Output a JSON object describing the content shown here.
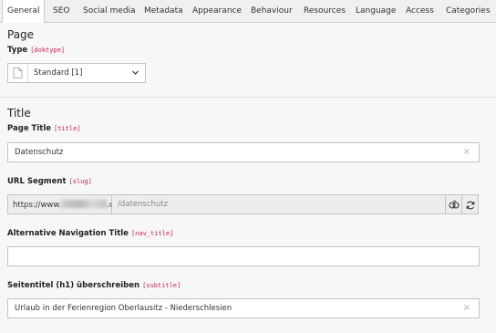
{
  "tabs": [
    {
      "label": "General",
      "active": true
    },
    {
      "label": "SEO"
    },
    {
      "label": "Social media"
    },
    {
      "label": "Metadata"
    },
    {
      "label": "Appearance"
    },
    {
      "label": "Behaviour"
    },
    {
      "label": "Resources"
    },
    {
      "label": "Language"
    },
    {
      "label": "Access"
    },
    {
      "label": "Categories"
    }
  ],
  "page_section": {
    "heading": "Page",
    "type_label": "Type",
    "type_field": "[doktype]",
    "type_value": "Standard [1]"
  },
  "title_section": {
    "heading": "Title",
    "page_title_label": "Page Title",
    "page_title_field": "[title]",
    "page_title_value": "Datenschutz",
    "slug_label": "URL Segment",
    "slug_field": "[slug]",
    "slug_prefix_start": "https://www.",
    "slug_prefix_end": ".de",
    "slug_value": "/datenschutz",
    "nav_title_label": "Alternative Navigation Title",
    "nav_title_field": "[nav_title]",
    "nav_title_value": "",
    "subtitle_label": "Seitentitel (h1) überschreiben",
    "subtitle_field": "[subtitle]",
    "subtitle_value": "Urlaub in der Ferienregion Oberlausitz - Niederschlesien"
  },
  "icons": {
    "clear": "×"
  }
}
